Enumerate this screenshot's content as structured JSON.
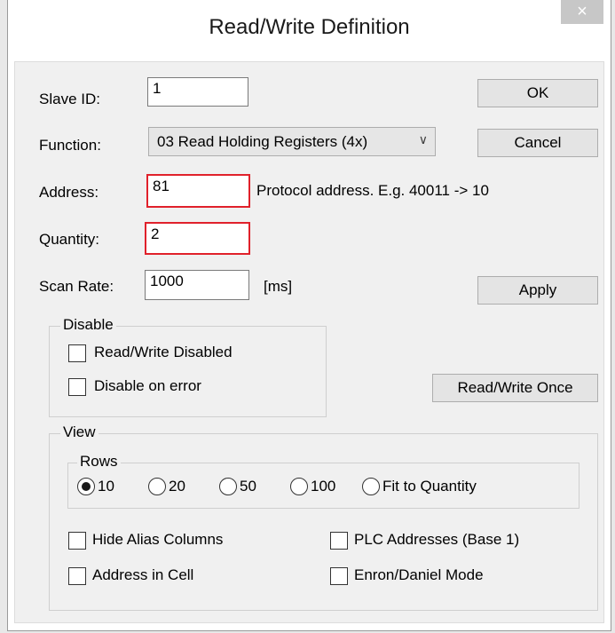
{
  "window": {
    "title": "Read/Write Definition",
    "close_glyph": "×"
  },
  "labels": {
    "slave_id": "Slave ID:",
    "function": "Function:",
    "address": "Address:",
    "quantity": "Quantity:",
    "scan_rate": "Scan Rate:",
    "address_hint": "Protocol address. E.g. 40011 -> 10",
    "scan_unit": "[ms]"
  },
  "fields": {
    "slave_id": "1",
    "function": "03 Read Holding Registers (4x)",
    "address": "81",
    "quantity": "2",
    "scan_rate": "1000"
  },
  "buttons": {
    "ok": "OK",
    "cancel": "Cancel",
    "apply": "Apply",
    "read_write_once": "Read/Write Once"
  },
  "disable_group": {
    "title": "Disable",
    "read_write_disabled": {
      "label": "Read/Write Disabled",
      "checked": false
    },
    "disable_on_error": {
      "label": "Disable on error",
      "checked": false
    }
  },
  "view_group": {
    "title": "View",
    "rows": {
      "title": "Rows",
      "options": [
        "10",
        "20",
        "50",
        "100",
        "Fit to Quantity"
      ],
      "selected": "10"
    },
    "hide_alias_columns": {
      "label": "Hide Alias Columns",
      "checked": false
    },
    "address_in_cell": {
      "label": "Address in Cell",
      "checked": false
    },
    "plc_addresses": {
      "label": "PLC Addresses (Base 1)",
      "checked": false
    },
    "enron_daniel_mode": {
      "label": "Enron/Daniel Mode",
      "checked": false
    }
  },
  "colors": {
    "highlight_border": "#e0212b",
    "client_bg": "#f0f0f0"
  }
}
